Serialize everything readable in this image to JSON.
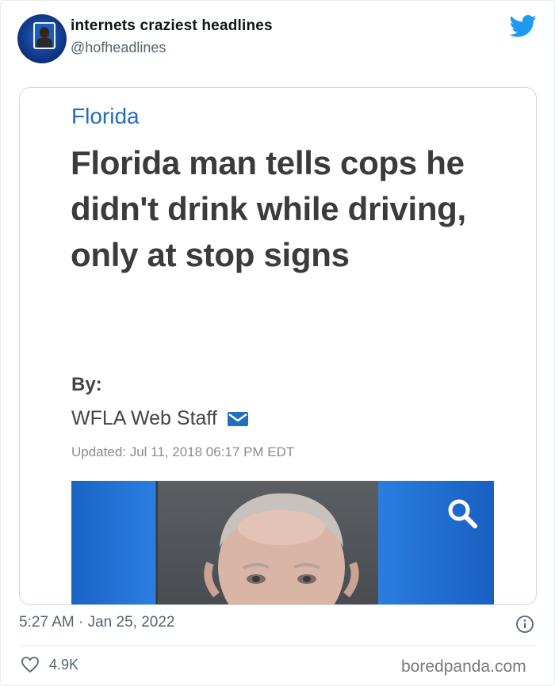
{
  "header": {
    "author_name": "internets craziest headlines",
    "author_handle": "@hofheadlines",
    "brand_color": "#1d9bf0"
  },
  "article": {
    "category": "Florida",
    "headline": "Florida man tells cops he didn't drink while driving, only at stop signs",
    "by_label": "By:",
    "byline": "WFLA Web Staff",
    "updated": "Updated: Jul 11, 2018 06:17 PM EDT",
    "accent_color": "#1f6fbe"
  },
  "footer": {
    "timestamp": "5:27 AM · Jan 25, 2022",
    "like_count": "4.9K",
    "watermark": "boredpanda.com"
  }
}
